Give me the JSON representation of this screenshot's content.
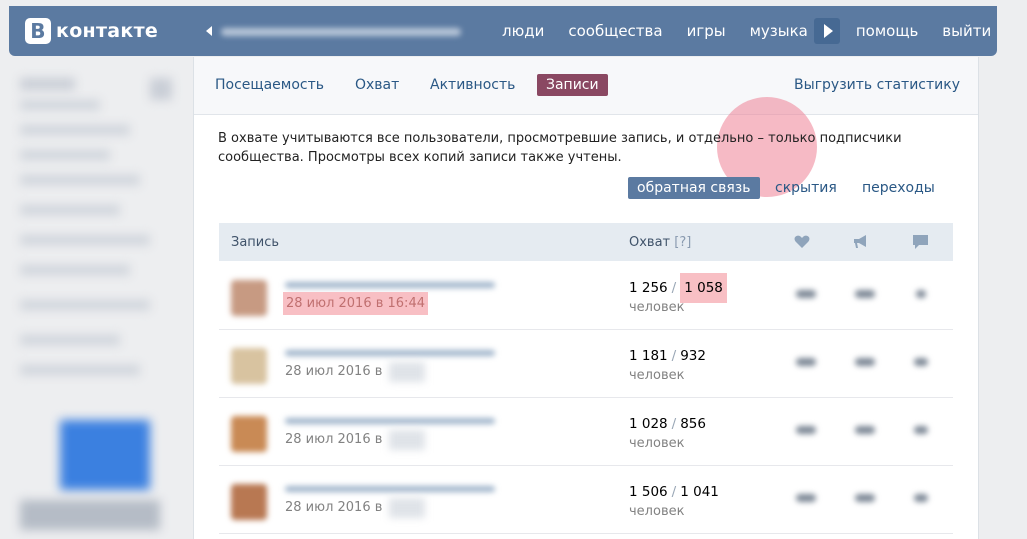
{
  "header": {
    "logo_text": "контакте",
    "logo_letter": "В",
    "nav": [
      "люди",
      "сообщества",
      "игры",
      "музыка",
      "помощь",
      "выйти"
    ]
  },
  "tabs": {
    "items": [
      "Посещаемость",
      "Охват",
      "Активность",
      "Записи"
    ],
    "active": "Записи",
    "export": "Выгрузить статистику"
  },
  "note": "В охвате учитываются все пользователи, просмотревшие запись, и отдельно – только подписчики сообщества. Просмотры всех копий записи также учтены.",
  "subtabs": {
    "items": [
      "обратная связь",
      "скрытия",
      "переходы"
    ],
    "active": "обратная связь"
  },
  "table": {
    "col_post": "Запись",
    "col_reach": "Охват",
    "col_reach_hint": "[?]",
    "people_label": "человек",
    "rows": [
      {
        "date": "28 июл 2016 в 16:44",
        "total": "1 256",
        "subscribers": "1 058",
        "highlight": true
      },
      {
        "date": "28 июл 2016 в",
        "total": "1 181",
        "subscribers": "932",
        "highlight": false
      },
      {
        "date": "28 июл 2016 в",
        "total": "1 028",
        "subscribers": "856",
        "highlight": false
      },
      {
        "date": "28 июл 2016 в",
        "total": "1 506",
        "subscribers": "1 041",
        "highlight": false
      }
    ]
  },
  "colors": {
    "header": "#5b7aa1",
    "active_tab": "#8a4862",
    "active_subtab": "#5b7aa1",
    "highlight": "#f8bfc4"
  }
}
